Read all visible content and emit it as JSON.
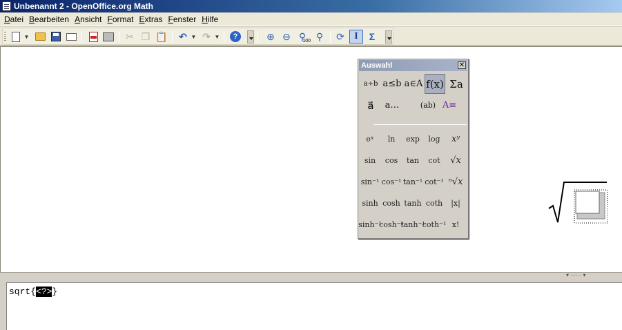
{
  "window": {
    "title": "Unbenannt 2 - OpenOffice.org Math"
  },
  "menu": [
    "Datei",
    "Bearbeiten",
    "Ansicht",
    "Format",
    "Extras",
    "Fenster",
    "Hilfe"
  ],
  "toolbar": {
    "icons": [
      "new-document-icon",
      "open-folder-icon",
      "save-icon",
      "email-icon",
      "export-pdf-icon",
      "print-icon",
      "cut-icon",
      "copy-icon",
      "paste-icon",
      "undo-icon",
      "redo-icon",
      "help-icon",
      "zoom-in-icon",
      "zoom-out-icon",
      "zoom-100-icon",
      "zoom-show-all-icon",
      "update-icon",
      "formula-cursor-icon",
      "symbols-icon"
    ],
    "zoom_label": "100"
  },
  "auswahl": {
    "title": "Auswahl",
    "close_glyph": "✕",
    "categories": [
      {
        "label": "a÷b",
        "name": "unary-binary-operators"
      },
      {
        "label": "a≤b",
        "name": "relations"
      },
      {
        "label": "a∈A",
        "name": "set-operations"
      },
      {
        "label": "f(x)",
        "name": "functions"
      },
      {
        "label": "Σa",
        "name": "operators"
      },
      {
        "label": "a⃗",
        "name": "attributes"
      },
      {
        "label": "a…",
        "name": "others"
      },
      {
        "label": "(ab)",
        "name": "brackets"
      },
      {
        "label": "A≡",
        "name": "formats"
      }
    ],
    "active_category": "f(x)",
    "elements": [
      [
        "eˣ",
        "ln",
        "exp",
        "log",
        "xʸ"
      ],
      [
        "sin",
        "cos",
        "tan",
        "cot",
        "√x"
      ],
      [
        "sin⁻¹",
        "cos⁻¹",
        "tan⁻¹",
        "cot⁻¹",
        "ⁿ√x"
      ],
      [
        "sinh",
        "cosh",
        "tanh",
        "coth",
        "|x|"
      ],
      [
        "sinh⁻¹",
        "cosh⁻¹",
        "tanh⁻¹",
        "coth⁻¹",
        "x!"
      ]
    ]
  },
  "command": {
    "before": "sqrt{",
    "placeholder": "<?>",
    "after": "}"
  },
  "colors": {
    "title_bar": "#0a246a",
    "selection": "#000000",
    "auswahl_title": "#8e9bb4"
  }
}
